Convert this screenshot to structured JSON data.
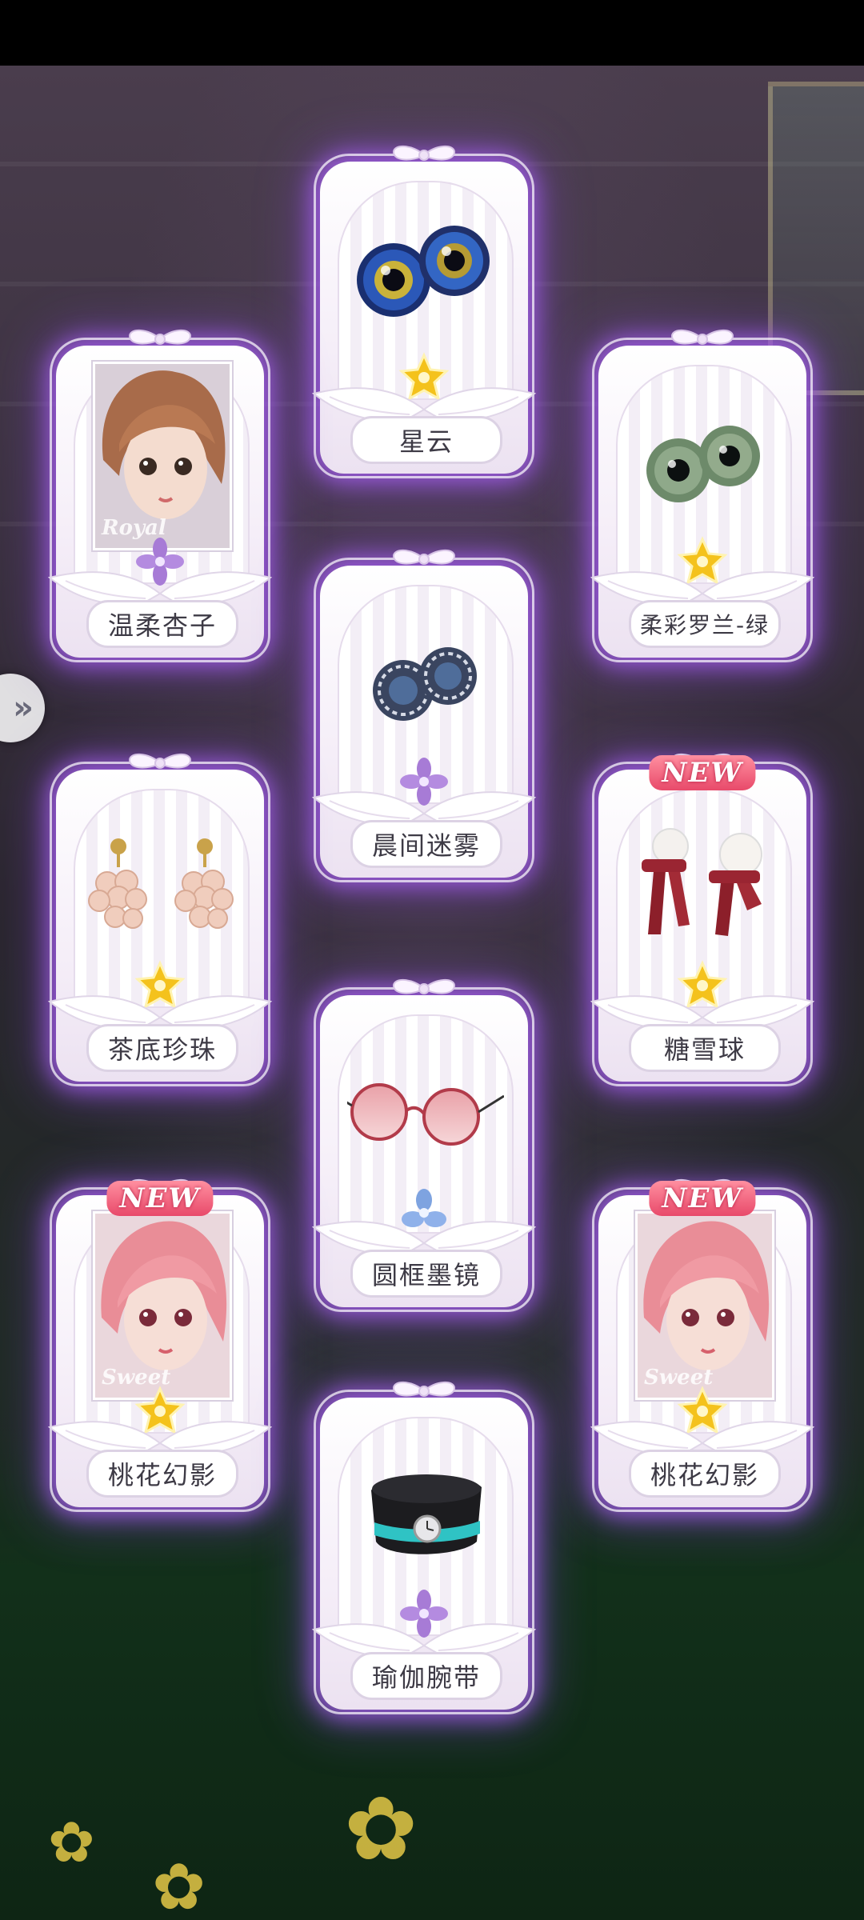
{
  "nav": {
    "side_tab_icon": "double-chevron-right-icon"
  },
  "cards": [
    {
      "name": "星云",
      "rarity": "gold-star",
      "art": "nebula-eyes"
    },
    {
      "name": "温柔杏子",
      "rarity": "purple-flower",
      "art": "portrait-apricot",
      "tag": "Royal"
    },
    {
      "name": "柔彩罗兰-绿",
      "rarity": "gold-star",
      "art": "green-eyes"
    },
    {
      "name": "晨间迷雾",
      "rarity": "purple-flower",
      "art": "mist-eyes"
    },
    {
      "name": "茶底珍珠",
      "rarity": "gold-star",
      "art": "pearl-earrings"
    },
    {
      "name": "糖雪球",
      "rarity": "gold-star",
      "art": "snowball-earrings",
      "badge": "NEW"
    },
    {
      "name": "圆框墨镜",
      "rarity": "blue-flower",
      "art": "round-sunglasses"
    },
    {
      "name": "桃花幻影",
      "rarity": "gold-star",
      "art": "portrait-peach",
      "tag": "Sweet",
      "badge": "NEW"
    },
    {
      "name": "桃花幻影",
      "rarity": "gold-star",
      "art": "portrait-peach",
      "tag": "Sweet",
      "badge": "NEW"
    },
    {
      "name": "瑜伽腕带",
      "rarity": "purple-flower",
      "art": "yoga-wristband"
    }
  ],
  "colors": {
    "glow": "#a55feb",
    "gold": "#f4c21c",
    "purple_flower": "#a77bd6",
    "blue_flower": "#7ea3e0",
    "new_badge": "#e84a6a"
  }
}
